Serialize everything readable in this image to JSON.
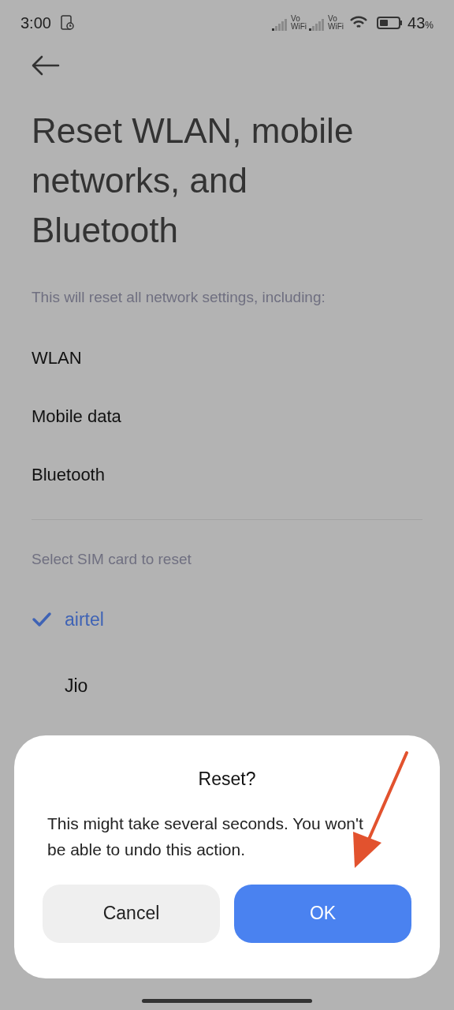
{
  "status_bar": {
    "time": "3:00",
    "sim_labels": [
      {
        "line1": "Vo",
        "line2": "WiFi"
      },
      {
        "line1": "Vo",
        "line2": "WiFi"
      }
    ],
    "battery": {
      "percent": "43",
      "unit": "%"
    }
  },
  "title": "Reset WLAN, mobile networks, and Bluetooth",
  "description": "This will reset all network settings, including:",
  "settings": [
    "WLAN",
    "Mobile data",
    "Bluetooth"
  ],
  "sim_section": {
    "label": "Select SIM card to reset",
    "sims": [
      {
        "name": "airtel",
        "selected": true
      },
      {
        "name": "Jio",
        "selected": false
      }
    ]
  },
  "dialog": {
    "title": "Reset?",
    "message": "This might take several seconds. You won't be able to undo this action.",
    "buttons": [
      {
        "label": "Cancel",
        "kind": "secondary"
      },
      {
        "label": "OK",
        "kind": "primary"
      }
    ]
  }
}
